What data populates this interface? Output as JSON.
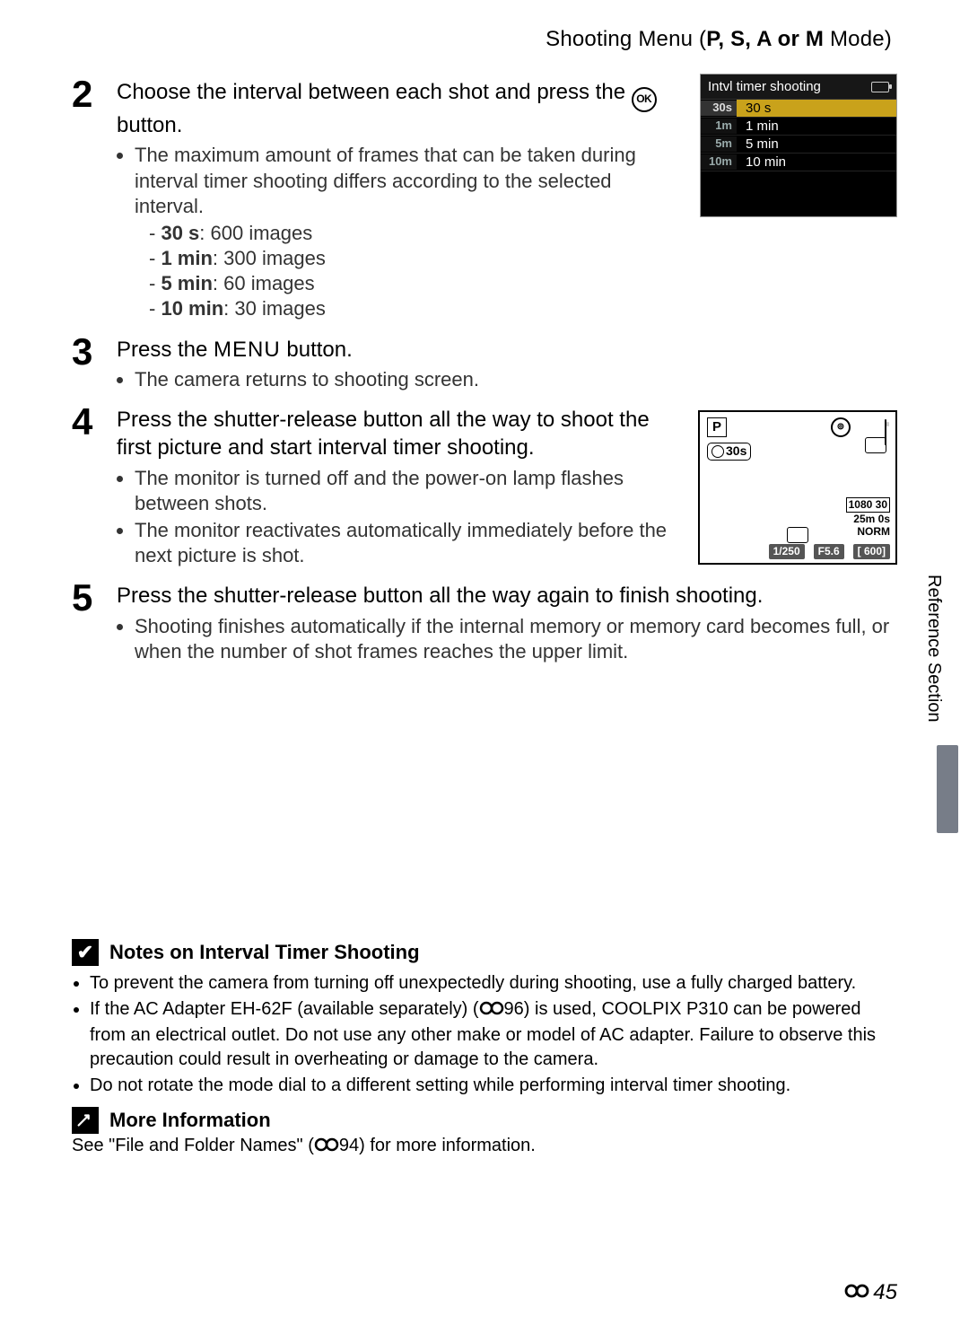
{
  "header": {
    "prefix": "Shooting Menu (",
    "modes": "P, S, A or M",
    "suffix": " Mode)"
  },
  "side_label": "Reference Section",
  "steps": {
    "s2": {
      "num": "2",
      "heading_a": "Choose the interval between each shot and press the ",
      "heading_b": " button.",
      "ok": "OK",
      "bullet1": "The maximum amount of frames that can be taken during interval timer shooting differs according to the selected interval.",
      "d1b": "30 s",
      "d1t": ": 600 images",
      "d2b": "1 min",
      "d2t": ": 300 images",
      "d3b": "5 min",
      "d3t": ": 60 images",
      "d4b": "10 min",
      "d4t": ": 30 images"
    },
    "s3": {
      "num": "3",
      "heading_a": "Press the ",
      "heading_menu": "MENU",
      "heading_b": " button.",
      "bullet1": "The camera returns to shooting screen."
    },
    "s4": {
      "num": "4",
      "heading": "Press the shutter-release button all the way to shoot the first picture and start interval timer shooting.",
      "bullet1": "The monitor is turned off and the power-on lamp flashes between shots.",
      "bullet2": "The monitor reactivates automatically immediately before the next picture is shot."
    },
    "s5": {
      "num": "5",
      "heading": "Press the shutter-release button all the way again to finish shooting.",
      "bullet1": "Shooting finishes automatically if the internal memory or memory card becomes full, or when the number of shot frames reaches the upper limit."
    }
  },
  "lcd_menu": {
    "title": "Intvl timer shooting",
    "rows": [
      {
        "icon": "30s",
        "label": "30 s",
        "selected": true
      },
      {
        "icon": "1m",
        "label": "1 min",
        "selected": false
      },
      {
        "icon": "5m",
        "label": "5 min",
        "selected": false
      },
      {
        "icon": "10m",
        "label": "10 min",
        "selected": false
      }
    ]
  },
  "lcd_shoot": {
    "mode": "P",
    "intvl": "30s",
    "res": "1080 30",
    "time": "25m 0s",
    "quality": "NORM",
    "shutter": "1/250",
    "fstop": "F5.6",
    "remaining": "[  600]"
  },
  "notes": {
    "title": "Notes on Interval Timer Shooting",
    "b1": "To prevent the camera from turning off unexpectedly during shooting, use a fully charged battery.",
    "b2a": "If the AC Adapter EH-62F (available separately) (",
    "b2b": "96) is used, COOLPIX P310 can be powered from an electrical outlet. Do not use any other make or model of AC adapter. Failure to observe this precaution could result in overheating or damage to the camera.",
    "b3": "Do not rotate the mode dial to a different setting while performing interval timer shooting."
  },
  "more": {
    "title": "More Information",
    "text_a": "See \"File and Folder Names\" (",
    "text_b": "94) for more information."
  },
  "page_number": "45"
}
